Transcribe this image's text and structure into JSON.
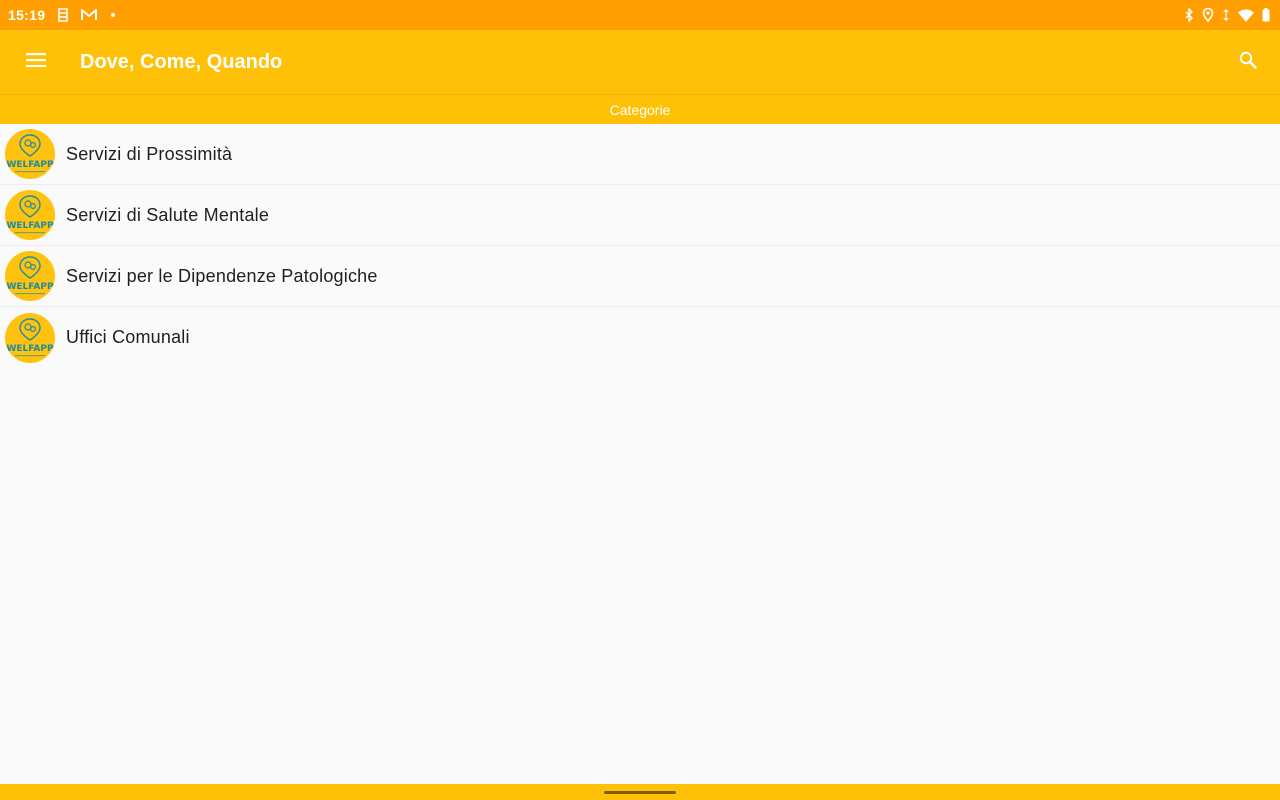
{
  "status_bar": {
    "time": "15:19",
    "left_icons": [
      "sim-icon",
      "gmail-icon",
      "notification-dot-icon"
    ],
    "right_icons": [
      "bluetooth-icon",
      "location-icon",
      "data-arrows-icon",
      "wifi-icon",
      "battery-icon"
    ]
  },
  "app_bar": {
    "title": "Dove, Come, Quando",
    "menu_icon": "hamburger-menu-icon",
    "search_icon": "search-icon",
    "background": "#ffc107"
  },
  "section_header": {
    "label": "Categorie"
  },
  "categories": [
    {
      "label": "Servizi di Prossimità",
      "logo_text": "WELFAPP"
    },
    {
      "label": "Servizi di Salute Mentale",
      "logo_text": "WELFAPP"
    },
    {
      "label": "Servizi per le Dipendenze Patologiche",
      "logo_text": "WELFAPP"
    },
    {
      "label": "Uffici Comunali",
      "logo_text": "WELFAPP"
    }
  ],
  "colors": {
    "status_bar": "#ffa000",
    "accent": "#ffc107",
    "logo_text": "#1b8ca6"
  }
}
